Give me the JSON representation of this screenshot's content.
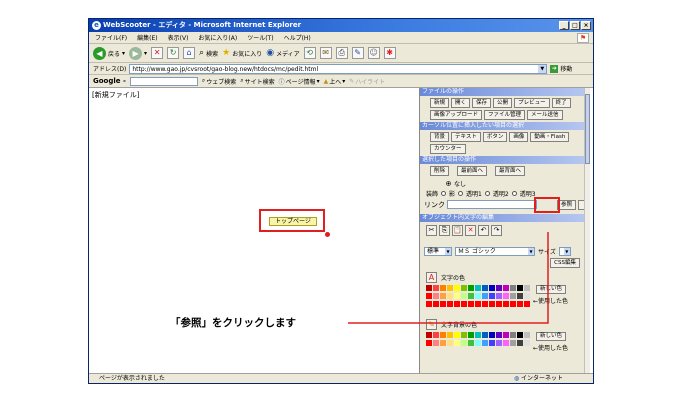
{
  "window": {
    "title": "WebScooter - エディタ - Microsoft Internet Explorer",
    "app_icon": "e",
    "controls": [
      "_",
      "□",
      "×"
    ]
  },
  "menubar": {
    "items": [
      "ファイル(F)",
      "編集(E)",
      "表示(V)",
      "お気に入り(A)",
      "ツール(T)",
      "ヘルプ(H)"
    ]
  },
  "toolbar": {
    "back_label": "戻る",
    "search_label": "検索",
    "favorites_label": "お気に入り",
    "media_label": "メディア"
  },
  "address": {
    "label": "アドレス(D)",
    "url": "http://www.gao.jp/cvsroot/gao-blog.new/htdocs/mc/pedit.html",
    "go_label": "移動"
  },
  "googlebar": {
    "logo": "Google -",
    "web_search_label": "ウェブ検索",
    "site_search_label": "サイト検索",
    "page_info_label": "ページ情報",
    "up_label": "上へ",
    "highlight_label": "ハイライト"
  },
  "editor": {
    "new_file_label": "[新規ファイル]",
    "top_page_button": "トップページ"
  },
  "panel": {
    "file_ops_title": "ファイルの操作",
    "file_ops": [
      "新規",
      "開く",
      "保存",
      "公開",
      "プレビュー",
      "終了"
    ],
    "file_ops2": [
      "画像アップロード",
      "ファイル管理",
      "メール送信"
    ],
    "insert_title": "カーソル位置に挿入したい項目の選択",
    "insert_items": [
      "背景",
      "テキスト",
      "ボタン",
      "画像",
      "動画・Flash"
    ],
    "insert_items2": [
      "カウンター"
    ],
    "selected_title": "選択した項目の操作",
    "selected_ops": [
      "削除",
      "最前面へ",
      "最背面へ"
    ],
    "decoration_label": "装飾",
    "decoration_none": "なし",
    "decoration_options": [
      "影",
      "透明1",
      "透明2",
      "透明3"
    ],
    "link_label": "リンク",
    "ref_button": "参照",
    "text_edit_title": "オブジェクト内文字の編集",
    "edit_icons": [
      "✂",
      "⎘",
      "📋",
      "✕",
      "↶",
      "↷"
    ],
    "size_select": "標準",
    "font_select": "ＭＳ ゴシック",
    "size_label": "サイズ",
    "css_edit_label": "CSS編集",
    "text_color_label": "文字の色",
    "text_bg_color_label": "文字背景の色",
    "new_color_label": "新しい色",
    "used_color_label": "←使用した色"
  },
  "statusbar": {
    "text": "ページが表示されました",
    "zone": "インターネット"
  },
  "callout": {
    "text": "「参照」をクリックします"
  },
  "colors": {
    "highlight_red": "#e02020",
    "title_blue": "#0a3fb0",
    "panel_header": "#6a8ad8"
  },
  "palette_rows": [
    [
      "#c00000",
      "#ff4040",
      "#ff8000",
      "#ffc000",
      "#ffff00",
      "#80c000",
      "#00a000",
      "#00c0c0",
      "#0060c0",
      "#0000c0",
      "#6000c0",
      "#c000c0",
      "#808080",
      "#000000",
      "#c0c0c0"
    ],
    [
      "#ff0000",
      "#ff8080",
      "#ffa040",
      "#ffe080",
      "#ffff80",
      "#c0ff80",
      "#40c040",
      "#80ffff",
      "#40a0ff",
      "#4040ff",
      "#a060ff",
      "#ff60ff",
      "#a0a0a0",
      "#404040",
      "#e0e0e0"
    ]
  ]
}
